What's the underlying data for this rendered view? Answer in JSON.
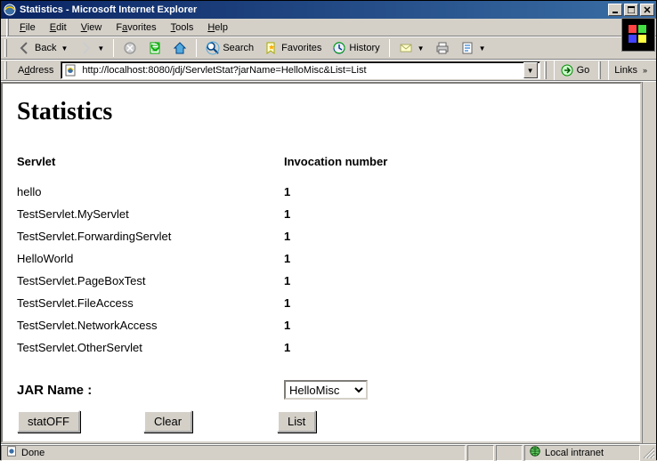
{
  "window": {
    "title": "Statistics - Microsoft Internet Explorer"
  },
  "menus": {
    "file": "File",
    "edit": "Edit",
    "view": "View",
    "favorites": "Favorites",
    "tools": "Tools",
    "help": "Help"
  },
  "toolbar": {
    "back": "Back",
    "search": "Search",
    "favorites": "Favorites",
    "history": "History"
  },
  "addressbar": {
    "label": "Address",
    "url": "http://localhost:8080/jdj/ServletStat?jarName=HelloMisc&List=List",
    "go": "Go",
    "links": "Links"
  },
  "page": {
    "heading": "Statistics",
    "columns": {
      "servlet": "Servlet",
      "invocation": "Invocation number"
    },
    "rows": [
      {
        "name": "hello",
        "count": "1"
      },
      {
        "name": "TestServlet.MyServlet",
        "count": "1"
      },
      {
        "name": "TestServlet.ForwardingServlet",
        "count": "1"
      },
      {
        "name": "HelloWorld",
        "count": "1"
      },
      {
        "name": "TestServlet.PageBoxTest",
        "count": "1"
      },
      {
        "name": "TestServlet.FileAccess",
        "count": "1"
      },
      {
        "name": "TestServlet.NetworkAccess",
        "count": "1"
      },
      {
        "name": "TestServlet.OtherServlet",
        "count": "1"
      }
    ],
    "jar_label": "JAR Name :",
    "jar_selected": "HelloMisc",
    "buttons": {
      "statoff": "statOFF",
      "clear": "Clear",
      "list": "List"
    }
  },
  "statusbar": {
    "done": "Done",
    "zone": "Local intranet"
  }
}
